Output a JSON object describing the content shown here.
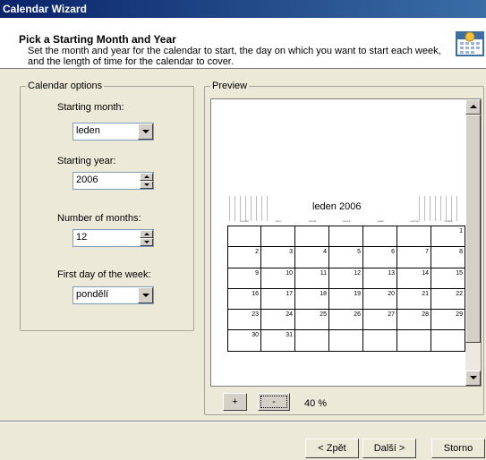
{
  "window": {
    "title": "Calendar Wizard"
  },
  "header": {
    "title": "Pick a Starting Month and Year",
    "description": "Set the month and year for the calendar to start, the day on which you want to start each week, and the length of time for the calendar to cover."
  },
  "options": {
    "group_label": "Calendar options",
    "starting_month": {
      "label": "Starting month:",
      "value": "leden"
    },
    "starting_year": {
      "label": "Starting year:",
      "value": "2006"
    },
    "number_of_months": {
      "label": "Number of months:",
      "value": "12"
    },
    "first_day": {
      "label": "First day of the week:",
      "value": "pondělí"
    }
  },
  "preview": {
    "group_label": "Preview",
    "calendar_title": "leden 2006",
    "day_names": [
      "pondělí",
      "úterý",
      "středa",
      "čtvrtek",
      "pátek",
      "sobota",
      "neděle"
    ],
    "weeks": [
      [
        "",
        "",
        "",
        "",
        "",
        "",
        "1"
      ],
      [
        "2",
        "3",
        "4",
        "5",
        "6",
        "7",
        "8"
      ],
      [
        "9",
        "10",
        "11",
        "12",
        "13",
        "14",
        "15"
      ],
      [
        "16",
        "17",
        "18",
        "19",
        "20",
        "21",
        "22"
      ],
      [
        "23",
        "24",
        "25",
        "26",
        "27",
        "28",
        "29"
      ],
      [
        "30",
        "31",
        "",
        "",
        "",
        "",
        ""
      ]
    ],
    "zoom_in_label": "+",
    "zoom_out_label": "-",
    "zoom_level": "40 %"
  },
  "footer": {
    "back_label": "< Zpět",
    "next_label": "Další >",
    "cancel_label": "Storno"
  }
}
